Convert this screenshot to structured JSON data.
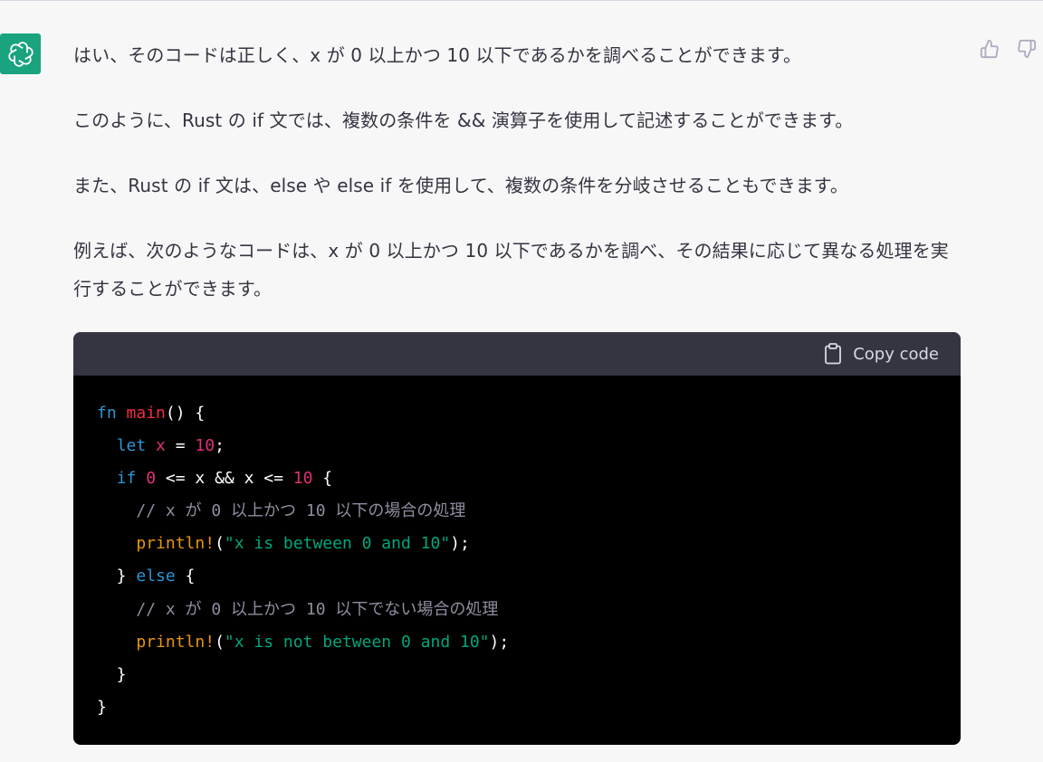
{
  "message": {
    "paragraphs": [
      "はい、そのコードは正しく、x が 0 以上かつ 10 以下であるかを調べることができます。",
      "このように、Rust の if 文では、複数の条件を && 演算子を使用して記述することができます。",
      "また、Rust の if 文は、else や else if を使用して、複数の条件を分岐させることもできます。",
      "例えば、次のようなコードは、x が 0 以上かつ 10 以下であるかを調べ、その結果に応じて異なる処理を実行することができます。"
    ]
  },
  "code_block": {
    "copy_label": "Copy code",
    "lines": [
      [
        {
          "t": "fn",
          "c": "kw"
        },
        {
          "t": " ",
          "c": ""
        },
        {
          "t": "main",
          "c": "fn"
        },
        {
          "t": "() {",
          "c": ""
        }
      ],
      [
        {
          "t": "  ",
          "c": ""
        },
        {
          "t": "let",
          "c": "kw"
        },
        {
          "t": " ",
          "c": ""
        },
        {
          "t": "x",
          "c": "var"
        },
        {
          "t": " = ",
          "c": ""
        },
        {
          "t": "10",
          "c": "num"
        },
        {
          "t": ";",
          "c": ""
        }
      ],
      [
        {
          "t": "  ",
          "c": ""
        },
        {
          "t": "if",
          "c": "kw"
        },
        {
          "t": " ",
          "c": ""
        },
        {
          "t": "0",
          "c": "num"
        },
        {
          "t": " <= x && x <= ",
          "c": ""
        },
        {
          "t": "10",
          "c": "num"
        },
        {
          "t": " {",
          "c": ""
        }
      ],
      [
        {
          "t": "    ",
          "c": ""
        },
        {
          "t": "// x が 0 以上かつ 10 以下の場合の処理",
          "c": "cm"
        }
      ],
      [
        {
          "t": "    ",
          "c": ""
        },
        {
          "t": "println!",
          "c": "mac"
        },
        {
          "t": "(",
          "c": ""
        },
        {
          "t": "\"x is between 0 and 10\"",
          "c": "str"
        },
        {
          "t": ");",
          "c": ""
        }
      ],
      [
        {
          "t": "  } ",
          "c": ""
        },
        {
          "t": "else",
          "c": "kw"
        },
        {
          "t": " {",
          "c": ""
        }
      ],
      [
        {
          "t": "    ",
          "c": ""
        },
        {
          "t": "// x が 0 以上かつ 10 以下でない場合の処理",
          "c": "cm"
        }
      ],
      [
        {
          "t": "    ",
          "c": ""
        },
        {
          "t": "println!",
          "c": "mac"
        },
        {
          "t": "(",
          "c": ""
        },
        {
          "t": "\"x is not between 0 and 10\"",
          "c": "str"
        },
        {
          "t": ");",
          "c": ""
        }
      ],
      [
        {
          "t": "  }",
          "c": ""
        }
      ],
      [
        {
          "t": "}",
          "c": ""
        }
      ]
    ]
  },
  "icons": {
    "avatar": "openai-logo-icon",
    "thumbs_up": "thumbs-up-icon",
    "thumbs_down": "thumbs-down-icon",
    "copy": "clipboard-icon"
  },
  "colors": {
    "accent": "#19a37f",
    "code_header_bg": "#343541",
    "code_bg": "#000000",
    "keyword": "#2e95d3",
    "function": "#f22c3d",
    "number": "#df3079",
    "comment": "#8e8ea0",
    "macro": "#e9950c",
    "string": "#00a67d"
  }
}
